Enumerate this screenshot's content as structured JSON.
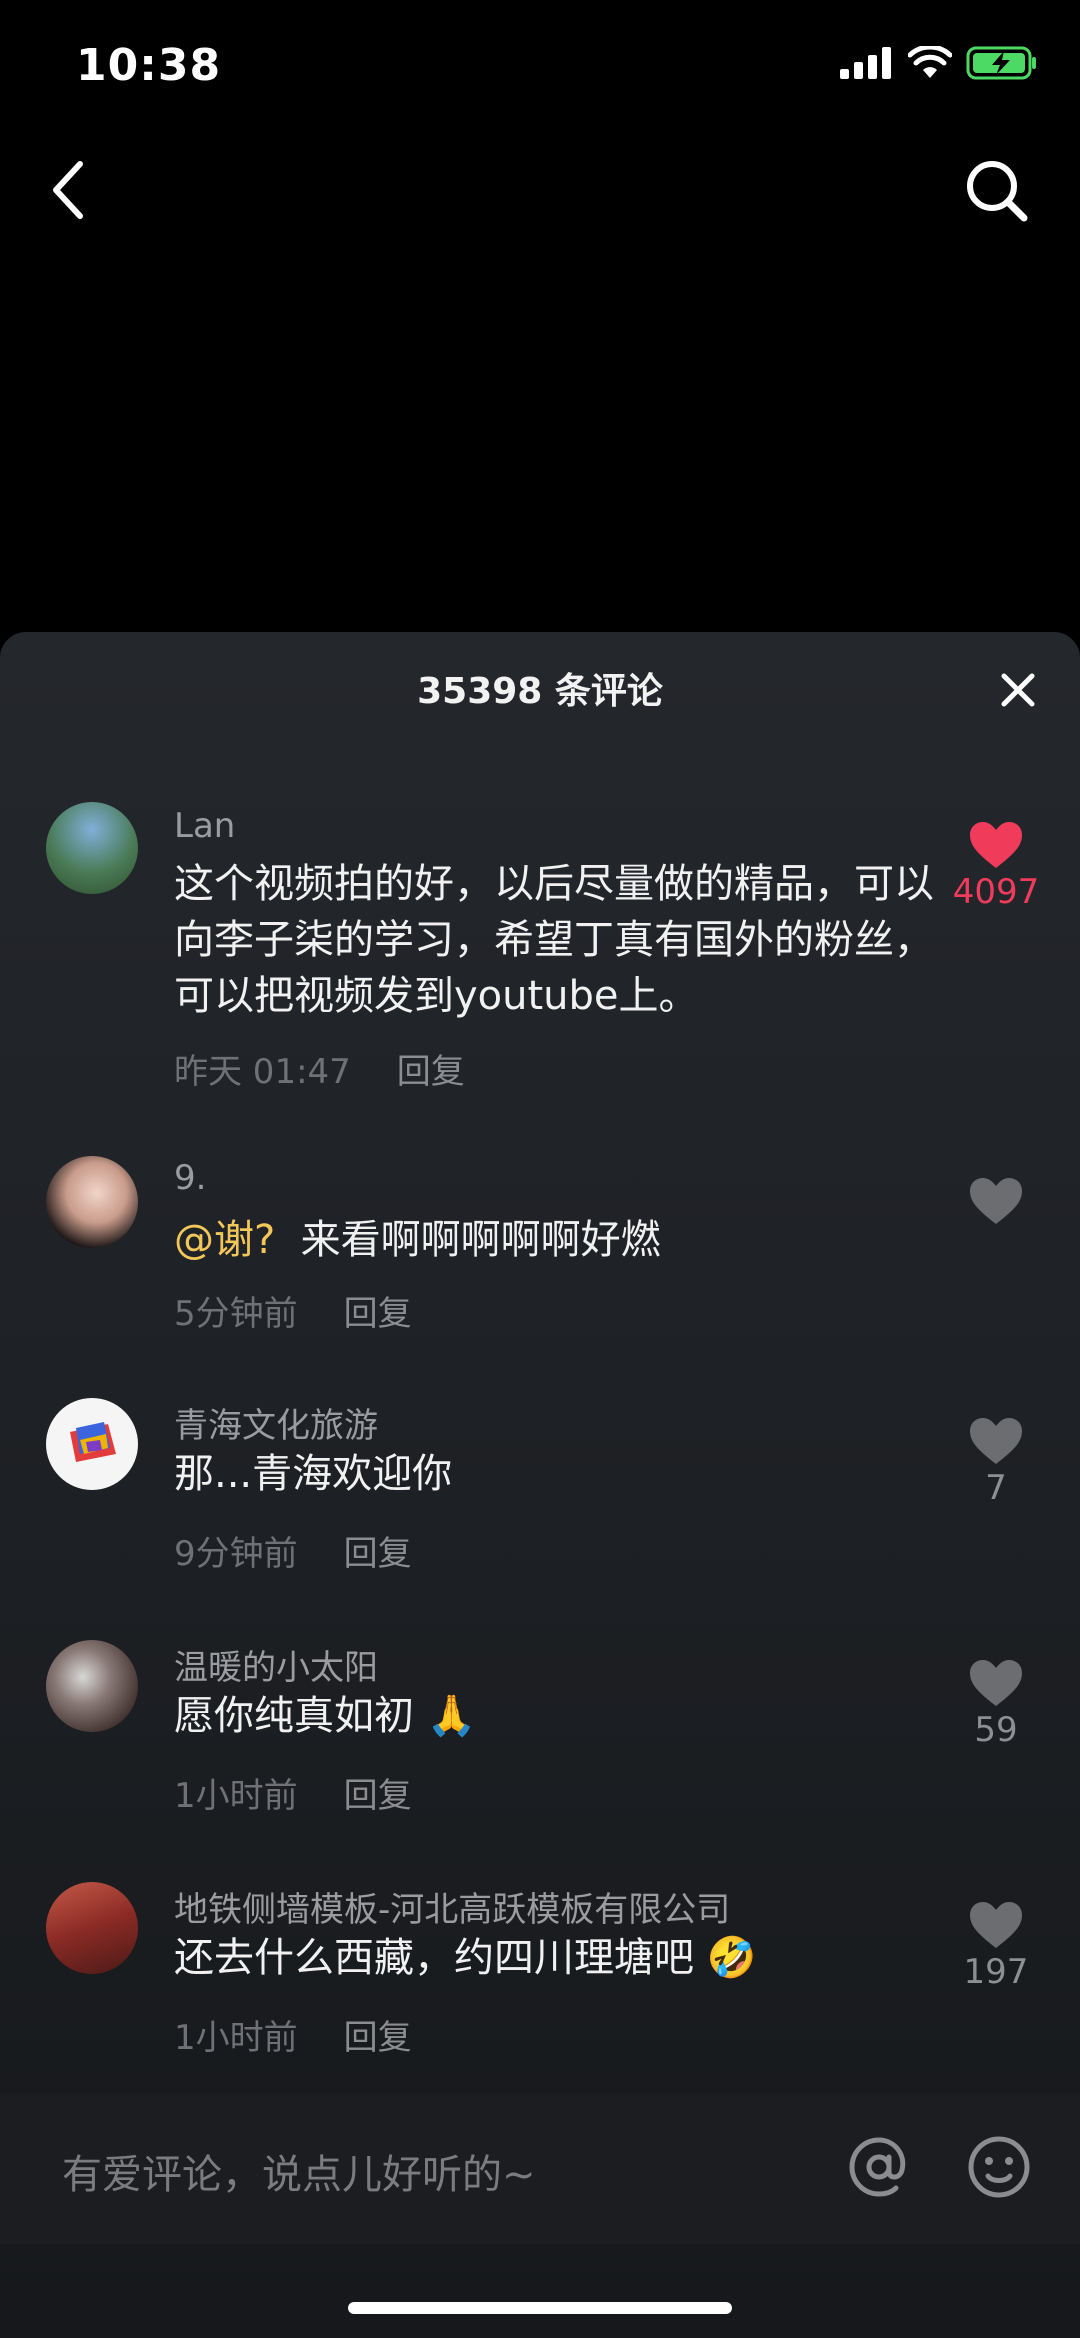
{
  "status_bar": {
    "time": "10:38"
  },
  "panel": {
    "title": "35398 条评论"
  },
  "comments": [
    {
      "author": "Lan",
      "text": "这个视频拍的好，以后尽量做的精品，可以向李子柒的学习，希望丁真有国外的粉丝，可以把视频发到youtube上。",
      "time": "昨天 01:47",
      "reply": "回复",
      "likes": "4097",
      "liked": true
    },
    {
      "author": "9.",
      "mention": "@谢?",
      "text": "来看啊啊啊啊啊好燃",
      "time": "5分钟前",
      "reply": "回复",
      "likes": "",
      "liked": false
    },
    {
      "author": "青海文化旅游",
      "text": "那...青海欢迎你",
      "time": "9分钟前",
      "reply": "回复",
      "likes": "7",
      "liked": false
    },
    {
      "author": "温暖的小太阳",
      "text": "愿你纯真如初 🙏",
      "time": "1小时前",
      "reply": "回复",
      "likes": "59",
      "liked": false
    },
    {
      "author": "地铁侧墙模板-河北高跃模板有限公司",
      "text": "还去什么西藏，约四川理塘吧 🤣",
      "time": "1小时前",
      "reply": "回复",
      "likes": "197",
      "liked": false
    }
  ],
  "input": {
    "placeholder": "有爱评论，说点儿好听的~"
  },
  "colors": {
    "accent_like": "#f03c5a",
    "mention": "#f3c65a",
    "battery": "#4cd964"
  },
  "icons": [
    "signal-icon",
    "wifi-icon",
    "battery-icon",
    "back-icon",
    "search-icon",
    "close-icon",
    "heart-icon",
    "at-icon",
    "emoji-icon"
  ]
}
